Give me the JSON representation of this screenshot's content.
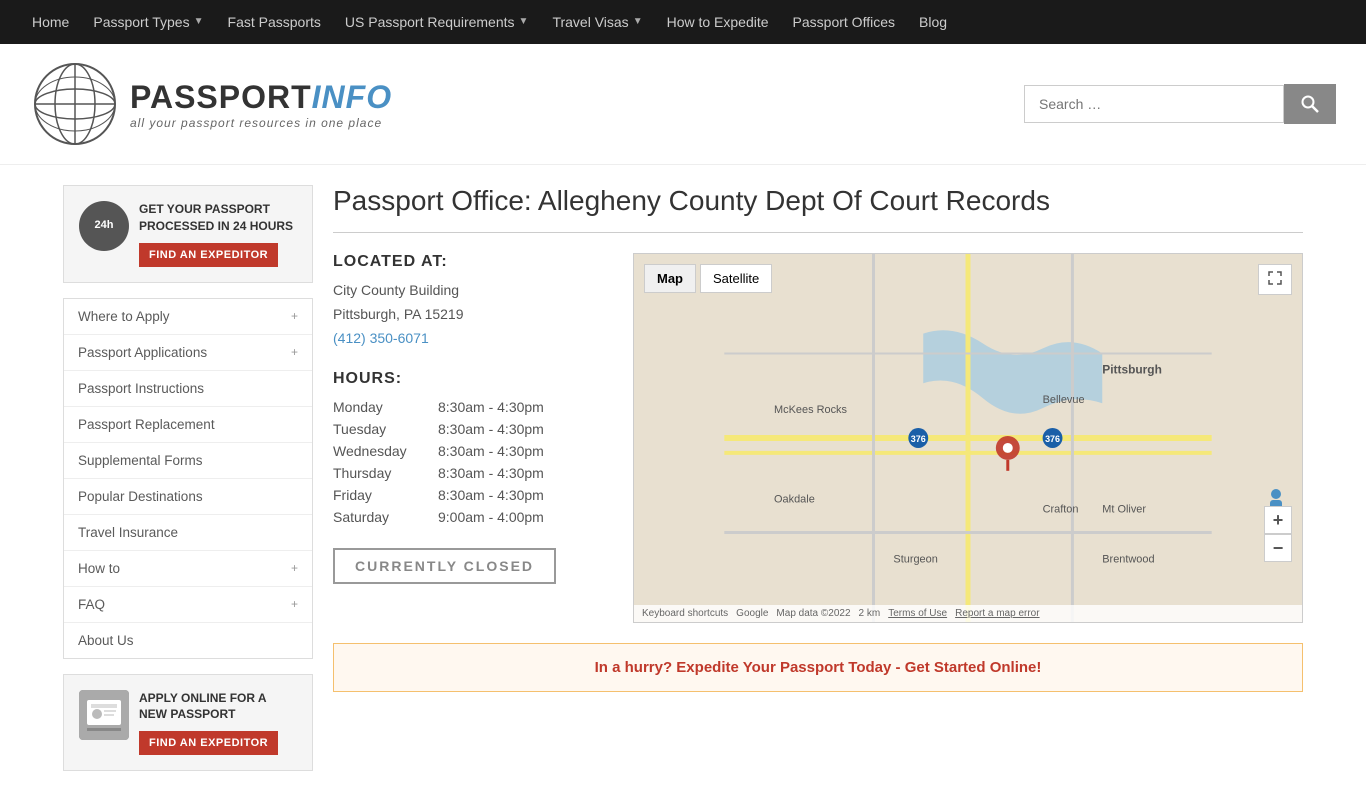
{
  "nav": {
    "items": [
      {
        "label": "Home",
        "href": "#",
        "dropdown": false
      },
      {
        "label": "Passport Types",
        "href": "#",
        "dropdown": true
      },
      {
        "label": "Fast Passports",
        "href": "#",
        "dropdown": false
      },
      {
        "label": "US Passport Requirements",
        "href": "#",
        "dropdown": true
      },
      {
        "label": "Travel Visas",
        "href": "#",
        "dropdown": true
      },
      {
        "label": "How to Expedite",
        "href": "#",
        "dropdown": false
      },
      {
        "label": "Passport Offices",
        "href": "#",
        "dropdown": false
      },
      {
        "label": "Blog",
        "href": "#",
        "dropdown": false
      }
    ]
  },
  "header": {
    "logo_part1": "PASSPORT",
    "logo_part2": "INFO",
    "tagline": "all your passport resources in one place",
    "search_placeholder": "Search …"
  },
  "sidebar": {
    "promo1": {
      "icon_text": "24h",
      "heading": "GET YOUR PASSPORT PROCESSED IN 24 HOURS",
      "button_label": "FIND AN EXPEDITOR"
    },
    "nav_items": [
      {
        "label": "Where to Apply",
        "has_chevron": true
      },
      {
        "label": "Passport Applications",
        "has_chevron": true
      },
      {
        "label": "Passport Instructions",
        "has_chevron": false
      },
      {
        "label": "Passport Replacement",
        "has_chevron": false
      },
      {
        "label": "Supplemental Forms",
        "has_chevron": false
      },
      {
        "label": "Popular Destinations",
        "has_chevron": false
      },
      {
        "label": "Travel Insurance",
        "has_chevron": false
      },
      {
        "label": "How to",
        "has_chevron": true
      },
      {
        "label": "FAQ",
        "has_chevron": true
      },
      {
        "label": "About Us",
        "has_chevron": false
      }
    ],
    "promo2": {
      "heading": "APPLY ONLINE FOR A NEW PASSPORT",
      "button_label": "FIND AN EXPEDITOR"
    }
  },
  "content": {
    "page_title": "Passport Office: Allegheny County Dept Of Court Records",
    "location_label": "LOCATED AT:",
    "address_line1": "City County Building",
    "address_line2": "Pittsburgh, PA 15219",
    "phone": "(412) 350-6071",
    "hours_label": "HOURS:",
    "hours": [
      {
        "day": "Monday",
        "hours": "8:30am - 4:30pm"
      },
      {
        "day": "Tuesday",
        "hours": "8:30am - 4:30pm"
      },
      {
        "day": "Wednesday",
        "hours": "8:30am - 4:30pm"
      },
      {
        "day": "Thursday",
        "hours": "8:30am - 4:30pm"
      },
      {
        "day": "Friday",
        "hours": "8:30am - 4:30pm"
      },
      {
        "day": "Saturday",
        "hours": "9:00am - 4:00pm"
      }
    ],
    "status": "CURRENTLY CLOSED",
    "map": {
      "tab_map": "Map",
      "tab_satellite": "Satellite",
      "footer_brand": "Google",
      "footer_data": "Map data ©2022",
      "footer_scale": "2 km",
      "footer_terms": "Terms of Use",
      "footer_report": "Report a map error",
      "keyboard_shortcuts": "Keyboard shortcuts"
    },
    "hurry_banner": "In a hurry? Expedite Your Passport Today - Get Started Online!"
  }
}
